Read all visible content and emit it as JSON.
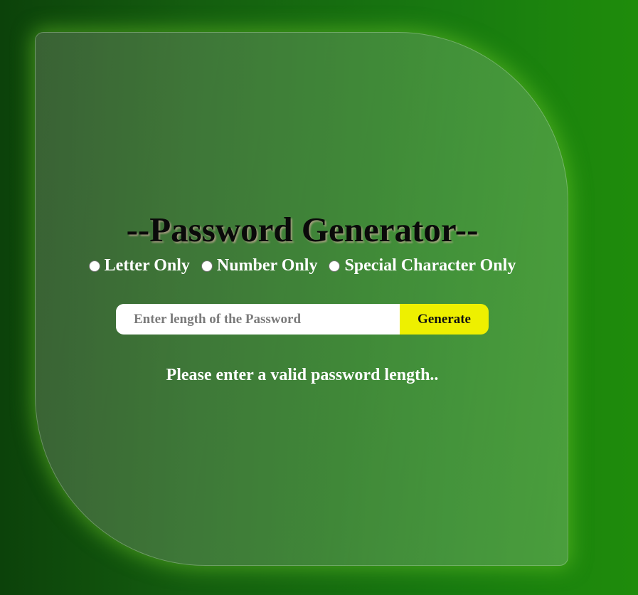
{
  "app": {
    "title": "--Password Generator--"
  },
  "options": [
    {
      "label": "Letter Only",
      "selected": false
    },
    {
      "label": "Number Only",
      "selected": false
    },
    {
      "label": "Special Character Only",
      "selected": false
    }
  ],
  "length_input": {
    "value": "",
    "placeholder": "Enter length of the Password"
  },
  "generate_button": {
    "label": "Generate"
  },
  "status": {
    "message": "Please enter a valid password length.."
  },
  "colors": {
    "background_dark": "#0c420a",
    "background_light": "#1f8c0b",
    "button": "#eef000",
    "text": "#ffffff",
    "title": "#0a0a0a"
  }
}
